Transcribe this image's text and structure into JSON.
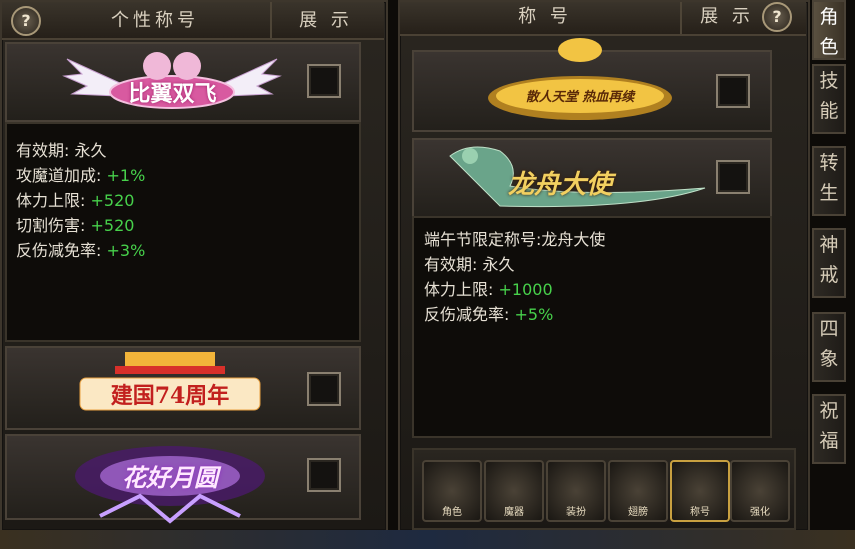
{
  "left_panel": {
    "header_title": "个性称号",
    "header_show": "展 示",
    "help": "?",
    "title_art": "比翼双飞",
    "info_lines": [
      {
        "label": "有效期:",
        "value": "永久",
        "green": false
      },
      {
        "label": "攻魔道加成:",
        "value": "+1%",
        "green": true
      },
      {
        "label": "体力上限:",
        "value": "+520",
        "green": true
      },
      {
        "label": "切割伤害:",
        "value": "+520",
        "green": true
      },
      {
        "label": "反伤减免率:",
        "value": "+3%",
        "green": true
      }
    ],
    "title_art_2": "建国74周年",
    "title_art_3": "花好月圆"
  },
  "right_panel": {
    "header_title": "称 号",
    "header_show": "展 示",
    "help": "?",
    "title_art_1": "散人天堂 热血再续",
    "title_art_2": "龙舟大使",
    "info_lines": [
      {
        "label": "端午节限定称号:",
        "value": "龙舟大使",
        "green": false
      },
      {
        "label": "有效期:",
        "value": "永久",
        "green": false
      },
      {
        "label": "体力上限:",
        "value": "+1000",
        "green": true
      },
      {
        "label": "反伤减免率:",
        "value": "+5%",
        "green": true
      }
    ],
    "bottom_icons": [
      "角色",
      "魔器",
      "装扮",
      "翅膀",
      "称号",
      "强化"
    ]
  },
  "side_tabs": [
    "角色",
    "技能",
    "转生",
    "神戒",
    "四象",
    "祝福"
  ],
  "colors": {
    "green": "#47d14b",
    "text": "#e6e0d4",
    "gold": "#f2c443"
  }
}
